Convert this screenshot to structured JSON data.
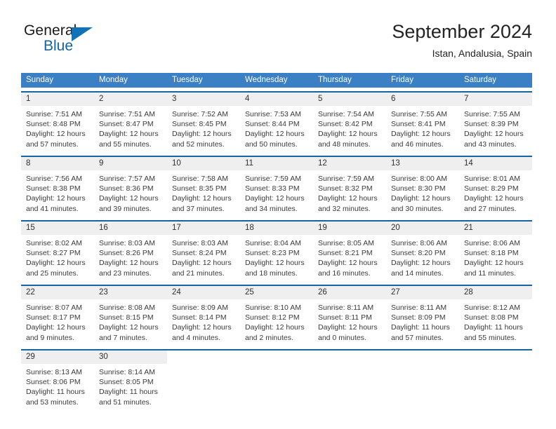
{
  "brand": {
    "name_part1": "General",
    "name_part2": "Blue",
    "flag_icon": "flag-icon"
  },
  "header": {
    "title": "September 2024",
    "subtitle": "Istan, Andalusia, Spain"
  },
  "weekdays": [
    "Sunday",
    "Monday",
    "Tuesday",
    "Wednesday",
    "Thursday",
    "Friday",
    "Saturday"
  ],
  "colors": {
    "header_blue": "#3b7fc4",
    "rule_blue": "#1464a5",
    "date_band": "#efefef",
    "brand_blue": "#1272b8",
    "text": "#3a3a3a"
  },
  "weeks": [
    [
      {
        "date": "1",
        "sunrise": "Sunrise: 7:51 AM",
        "sunset": "Sunset: 8:48 PM",
        "daylight1": "Daylight: 12 hours",
        "daylight2": "and 57 minutes."
      },
      {
        "date": "2",
        "sunrise": "Sunrise: 7:51 AM",
        "sunset": "Sunset: 8:47 PM",
        "daylight1": "Daylight: 12 hours",
        "daylight2": "and 55 minutes."
      },
      {
        "date": "3",
        "sunrise": "Sunrise: 7:52 AM",
        "sunset": "Sunset: 8:45 PM",
        "daylight1": "Daylight: 12 hours",
        "daylight2": "and 52 minutes."
      },
      {
        "date": "4",
        "sunrise": "Sunrise: 7:53 AM",
        "sunset": "Sunset: 8:44 PM",
        "daylight1": "Daylight: 12 hours",
        "daylight2": "and 50 minutes."
      },
      {
        "date": "5",
        "sunrise": "Sunrise: 7:54 AM",
        "sunset": "Sunset: 8:42 PM",
        "daylight1": "Daylight: 12 hours",
        "daylight2": "and 48 minutes."
      },
      {
        "date": "6",
        "sunrise": "Sunrise: 7:55 AM",
        "sunset": "Sunset: 8:41 PM",
        "daylight1": "Daylight: 12 hours",
        "daylight2": "and 46 minutes."
      },
      {
        "date": "7",
        "sunrise": "Sunrise: 7:55 AM",
        "sunset": "Sunset: 8:39 PM",
        "daylight1": "Daylight: 12 hours",
        "daylight2": "and 43 minutes."
      }
    ],
    [
      {
        "date": "8",
        "sunrise": "Sunrise: 7:56 AM",
        "sunset": "Sunset: 8:38 PM",
        "daylight1": "Daylight: 12 hours",
        "daylight2": "and 41 minutes."
      },
      {
        "date": "9",
        "sunrise": "Sunrise: 7:57 AM",
        "sunset": "Sunset: 8:36 PM",
        "daylight1": "Daylight: 12 hours",
        "daylight2": "and 39 minutes."
      },
      {
        "date": "10",
        "sunrise": "Sunrise: 7:58 AM",
        "sunset": "Sunset: 8:35 PM",
        "daylight1": "Daylight: 12 hours",
        "daylight2": "and 37 minutes."
      },
      {
        "date": "11",
        "sunrise": "Sunrise: 7:59 AM",
        "sunset": "Sunset: 8:33 PM",
        "daylight1": "Daylight: 12 hours",
        "daylight2": "and 34 minutes."
      },
      {
        "date": "12",
        "sunrise": "Sunrise: 7:59 AM",
        "sunset": "Sunset: 8:32 PM",
        "daylight1": "Daylight: 12 hours",
        "daylight2": "and 32 minutes."
      },
      {
        "date": "13",
        "sunrise": "Sunrise: 8:00 AM",
        "sunset": "Sunset: 8:30 PM",
        "daylight1": "Daylight: 12 hours",
        "daylight2": "and 30 minutes."
      },
      {
        "date": "14",
        "sunrise": "Sunrise: 8:01 AM",
        "sunset": "Sunset: 8:29 PM",
        "daylight1": "Daylight: 12 hours",
        "daylight2": "and 27 minutes."
      }
    ],
    [
      {
        "date": "15",
        "sunrise": "Sunrise: 8:02 AM",
        "sunset": "Sunset: 8:27 PM",
        "daylight1": "Daylight: 12 hours",
        "daylight2": "and 25 minutes."
      },
      {
        "date": "16",
        "sunrise": "Sunrise: 8:03 AM",
        "sunset": "Sunset: 8:26 PM",
        "daylight1": "Daylight: 12 hours",
        "daylight2": "and 23 minutes."
      },
      {
        "date": "17",
        "sunrise": "Sunrise: 8:03 AM",
        "sunset": "Sunset: 8:24 PM",
        "daylight1": "Daylight: 12 hours",
        "daylight2": "and 21 minutes."
      },
      {
        "date": "18",
        "sunrise": "Sunrise: 8:04 AM",
        "sunset": "Sunset: 8:23 PM",
        "daylight1": "Daylight: 12 hours",
        "daylight2": "and 18 minutes."
      },
      {
        "date": "19",
        "sunrise": "Sunrise: 8:05 AM",
        "sunset": "Sunset: 8:21 PM",
        "daylight1": "Daylight: 12 hours",
        "daylight2": "and 16 minutes."
      },
      {
        "date": "20",
        "sunrise": "Sunrise: 8:06 AM",
        "sunset": "Sunset: 8:20 PM",
        "daylight1": "Daylight: 12 hours",
        "daylight2": "and 14 minutes."
      },
      {
        "date": "21",
        "sunrise": "Sunrise: 8:06 AM",
        "sunset": "Sunset: 8:18 PM",
        "daylight1": "Daylight: 12 hours",
        "daylight2": "and 11 minutes."
      }
    ],
    [
      {
        "date": "22",
        "sunrise": "Sunrise: 8:07 AM",
        "sunset": "Sunset: 8:17 PM",
        "daylight1": "Daylight: 12 hours",
        "daylight2": "and 9 minutes."
      },
      {
        "date": "23",
        "sunrise": "Sunrise: 8:08 AM",
        "sunset": "Sunset: 8:15 PM",
        "daylight1": "Daylight: 12 hours",
        "daylight2": "and 7 minutes."
      },
      {
        "date": "24",
        "sunrise": "Sunrise: 8:09 AM",
        "sunset": "Sunset: 8:14 PM",
        "daylight1": "Daylight: 12 hours",
        "daylight2": "and 4 minutes."
      },
      {
        "date": "25",
        "sunrise": "Sunrise: 8:10 AM",
        "sunset": "Sunset: 8:12 PM",
        "daylight1": "Daylight: 12 hours",
        "daylight2": "and 2 minutes."
      },
      {
        "date": "26",
        "sunrise": "Sunrise: 8:11 AM",
        "sunset": "Sunset: 8:11 PM",
        "daylight1": "Daylight: 12 hours",
        "daylight2": "and 0 minutes."
      },
      {
        "date": "27",
        "sunrise": "Sunrise: 8:11 AM",
        "sunset": "Sunset: 8:09 PM",
        "daylight1": "Daylight: 11 hours",
        "daylight2": "and 57 minutes."
      },
      {
        "date": "28",
        "sunrise": "Sunrise: 8:12 AM",
        "sunset": "Sunset: 8:08 PM",
        "daylight1": "Daylight: 11 hours",
        "daylight2": "and 55 minutes."
      }
    ],
    [
      {
        "date": "29",
        "sunrise": "Sunrise: 8:13 AM",
        "sunset": "Sunset: 8:06 PM",
        "daylight1": "Daylight: 11 hours",
        "daylight2": "and 53 minutes."
      },
      {
        "date": "30",
        "sunrise": "Sunrise: 8:14 AM",
        "sunset": "Sunset: 8:05 PM",
        "daylight1": "Daylight: 11 hours",
        "daylight2": "and 51 minutes."
      },
      {
        "date": "",
        "sunrise": "",
        "sunset": "",
        "daylight1": "",
        "daylight2": ""
      },
      {
        "date": "",
        "sunrise": "",
        "sunset": "",
        "daylight1": "",
        "daylight2": ""
      },
      {
        "date": "",
        "sunrise": "",
        "sunset": "",
        "daylight1": "",
        "daylight2": ""
      },
      {
        "date": "",
        "sunrise": "",
        "sunset": "",
        "daylight1": "",
        "daylight2": ""
      },
      {
        "date": "",
        "sunrise": "",
        "sunset": "",
        "daylight1": "",
        "daylight2": ""
      }
    ]
  ]
}
